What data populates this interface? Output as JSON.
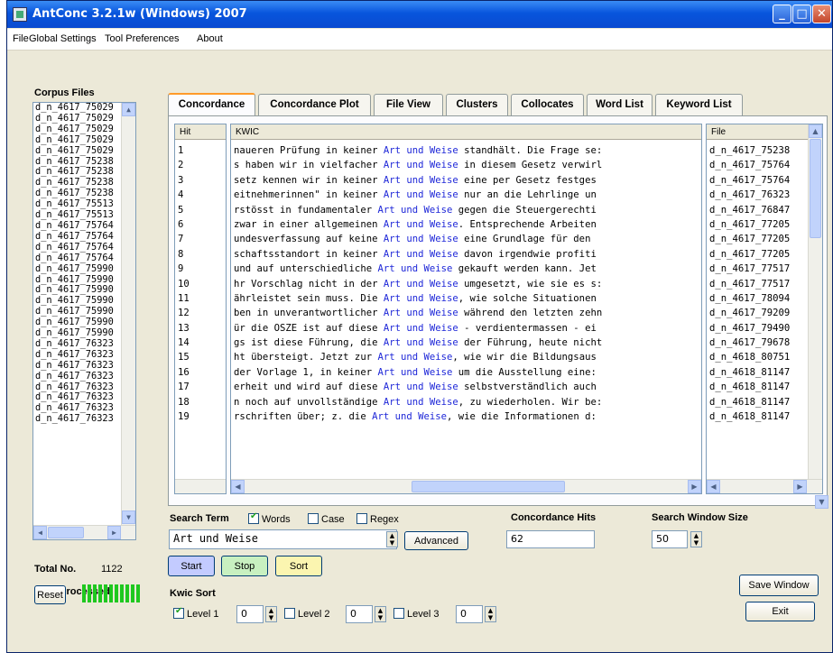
{
  "window": {
    "title": "AntConc 3.2.1w (Windows) 2007"
  },
  "menu": [
    "File",
    "Global Settings",
    "Tool Preferences",
    "About"
  ],
  "corpus": {
    "label": "Corpus Files",
    "files": [
      "d_n_4617_75029",
      "d_n_4617_75029",
      "d_n_4617_75029",
      "d_n_4617_75029",
      "d_n_4617_75029",
      "d_n_4617_75238",
      "d_n_4617_75238",
      "d_n_4617_75238",
      "d_n_4617_75238",
      "d_n_4617_75513",
      "d_n_4617_75513",
      "d_n_4617_75764",
      "d_n_4617_75764",
      "d_n_4617_75764",
      "d_n_4617_75764",
      "d_n_4617_75990",
      "d_n_4617_75990",
      "d_n_4617_75990",
      "d_n_4617_75990",
      "d_n_4617_75990",
      "d_n_4617_75990",
      "d_n_4617_75990",
      "d_n_4617_76323",
      "d_n_4617_76323",
      "d_n_4617_76323",
      "d_n_4617_76323",
      "d_n_4617_76323",
      "d_n_4617_76323",
      "d_n_4617_76323",
      "d_n_4617_76323"
    ],
    "total_label": "Total No.",
    "total_value": "1122",
    "processed_label": "Files Processed",
    "reset_label": "Reset"
  },
  "tabs": [
    "Concordance",
    "Concordance Plot",
    "File View",
    "Clusters",
    "Collocates",
    "Word List",
    "Keyword List"
  ],
  "table": {
    "hit_header": "Hit",
    "kwic_header": "KWIC",
    "file_header": "File",
    "rows": [
      {
        "hit": "1",
        "left": "naueren Prüfung in keiner ",
        "kw": "Art und Weise",
        "right": " standhält. Die Frage se:",
        "file": "d_n_4617_75238"
      },
      {
        "hit": "2",
        "left": "s haben wir in vielfacher ",
        "kw": "Art und Weise",
        "right": " in diesem Gesetz verwirl",
        "file": "d_n_4617_75764"
      },
      {
        "hit": "3",
        "left": "setz kennen wir in keiner ",
        "kw": "Art und Weise",
        "right": " eine per Gesetz festges",
        "file": "d_n_4617_75764"
      },
      {
        "hit": "4",
        "left": "eitnehmerinnen\" in keiner ",
        "kw": "Art und Weise",
        "right": " nur an die Lehrlinge un",
        "file": "d_n_4617_76323"
      },
      {
        "hit": "5",
        "left": "rstösst in fundamentaler ",
        "kw": "Art und Weise",
        "right": " gegen die Steuergerechti",
        "file": "d_n_4617_76847"
      },
      {
        "hit": "6",
        "left": "zwar in einer allgemeinen ",
        "kw": "Art und Weise",
        "right": ". Entsprechende Arbeiten",
        "file": "d_n_4617_77205"
      },
      {
        "hit": "7",
        "left": "undesverfassung auf keine ",
        "kw": "Art und Weise",
        "right": " eine Grundlage für den ",
        "file": "d_n_4617_77205"
      },
      {
        "hit": "8",
        "left": "schaftsstandort in keiner ",
        "kw": "Art und Weise",
        "right": " davon irgendwie profiti",
        "file": "d_n_4617_77205"
      },
      {
        "hit": "9",
        "left": " und auf unterschiedliche ",
        "kw": "Art und Weise",
        "right": " gekauft werden kann. Jet",
        "file": "d_n_4617_77517"
      },
      {
        "hit": "10",
        "left": "hr Vorschlag nicht in der ",
        "kw": "Art und Weise",
        "right": " umgesetzt, wie sie es s:",
        "file": "d_n_4617_77517"
      },
      {
        "hit": "11",
        "left": "ährleistet sein muss. Die ",
        "kw": "Art und Weise",
        "right": ", wie solche Situationen",
        "file": "d_n_4617_78094"
      },
      {
        "hit": "12",
        "left": "ben in unverantwortlicher ",
        "kw": "Art und Weise",
        "right": " während den letzten zehn",
        "file": "d_n_4617_79209"
      },
      {
        "hit": "13",
        "left": "ür die OSZE ist auf diese ",
        "kw": "Art und Weise",
        "right": " - verdientermassen - ei",
        "file": "d_n_4617_79490"
      },
      {
        "hit": "14",
        "left": "gs ist diese Führung, die ",
        "kw": "Art und Weise",
        "right": " der Führung, heute nicht",
        "file": "d_n_4617_79678"
      },
      {
        "hit": "15",
        "left": "ht übersteigt. Jetzt zur ",
        "kw": "Art und Weise",
        "right": ", wie wir die Bildungsaus",
        "file": "d_n_4618_80751"
      },
      {
        "hit": "16",
        "left": " der Vorlage 1, in keiner ",
        "kw": "Art und Weise",
        "right": " um die Ausstellung eine:",
        "file": "d_n_4618_81147"
      },
      {
        "hit": "17",
        "left": "erheit und wird auf diese ",
        "kw": "Art und Weise",
        "right": " selbstverständlich auch",
        "file": "d_n_4618_81147"
      },
      {
        "hit": "18",
        "left": "n noch auf unvollständige ",
        "kw": "Art und Weise",
        "right": ", zu wiederholen. Wir be:",
        "file": "d_n_4618_81147"
      },
      {
        "hit": "19",
        "left": "rschriften über; z. die ",
        "kw": "Art und Weise",
        "right": ", wie die Informationen d:",
        "file": "d_n_4618_81147"
      }
    ]
  },
  "search": {
    "label": "Search Term",
    "words_label": "Words",
    "words_checked": true,
    "case_label": "Case",
    "regex_label": "Regex",
    "term": "Art und Weise",
    "advanced_label": "Advanced",
    "start_label": "Start",
    "stop_label": "Stop",
    "sort_label": "Sort"
  },
  "hits": {
    "label": "Concordance Hits",
    "value": "62"
  },
  "window_size": {
    "label": "Search Window Size",
    "value": "50"
  },
  "kwic_sort": {
    "label": "Kwic Sort",
    "levels": [
      {
        "label": "Level 1",
        "value": "0",
        "checked": true
      },
      {
        "label": "Level 2",
        "value": "0",
        "checked": false
      },
      {
        "label": "Level 3",
        "value": "0",
        "checked": false
      }
    ]
  },
  "save_window_label": "Save Window",
  "exit_label": "Exit",
  "colors": {
    "keyword": "#1e27d8",
    "start": "#c3cbff",
    "stop": "#c8f0c0",
    "sort": "#fbf5b0",
    "progress": "#1fc81f"
  }
}
